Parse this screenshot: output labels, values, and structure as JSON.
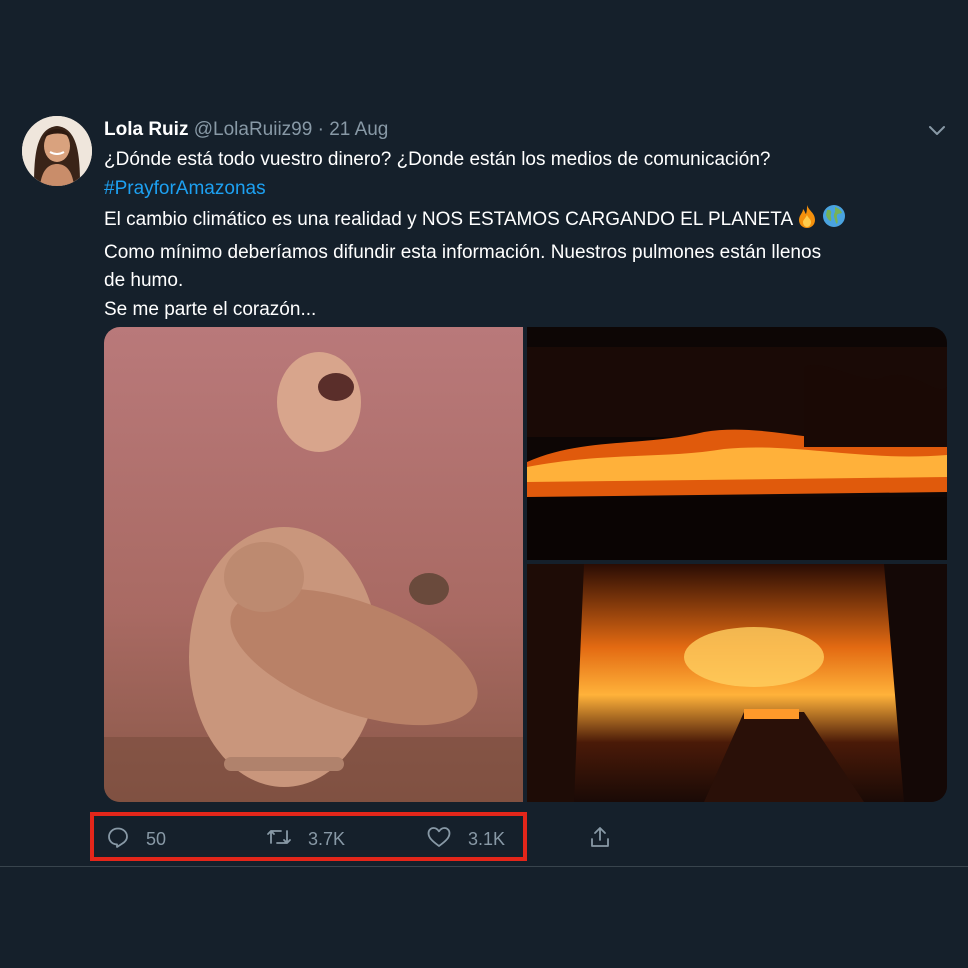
{
  "tweet": {
    "display_name": "Lola Ruiz",
    "handle": "@LolaRuiiz99",
    "separator": "·",
    "date": "21 Aug",
    "lines": {
      "l1": "¿Dónde está todo vuestro dinero? ¿Donde están los medios de comunicación?",
      "hashtag": "#PrayforAmazonas",
      "l3": "El cambio climático es una realidad y NOS ESTAMOS CARGANDO EL PLANETA",
      "l4": "Como mínimo deberíamos difundir esta información. Nuestros pulmones están llenos",
      "l5": "de humo.",
      "l6": "Se me parte el corazón..."
    },
    "emojis": [
      "fire-emoji",
      "globe-emoji"
    ]
  },
  "actions": {
    "reply_count": "50",
    "retweet_count": "3.7K",
    "like_count": "3.1K"
  },
  "colors": {
    "background": "#15202b",
    "secondary_text": "#8899a6",
    "link": "#1da1f2",
    "highlight_box": "#e3261a"
  },
  "icons": [
    "reply-icon",
    "retweet-icon",
    "like-icon",
    "share-icon",
    "chevron-down-icon"
  ]
}
